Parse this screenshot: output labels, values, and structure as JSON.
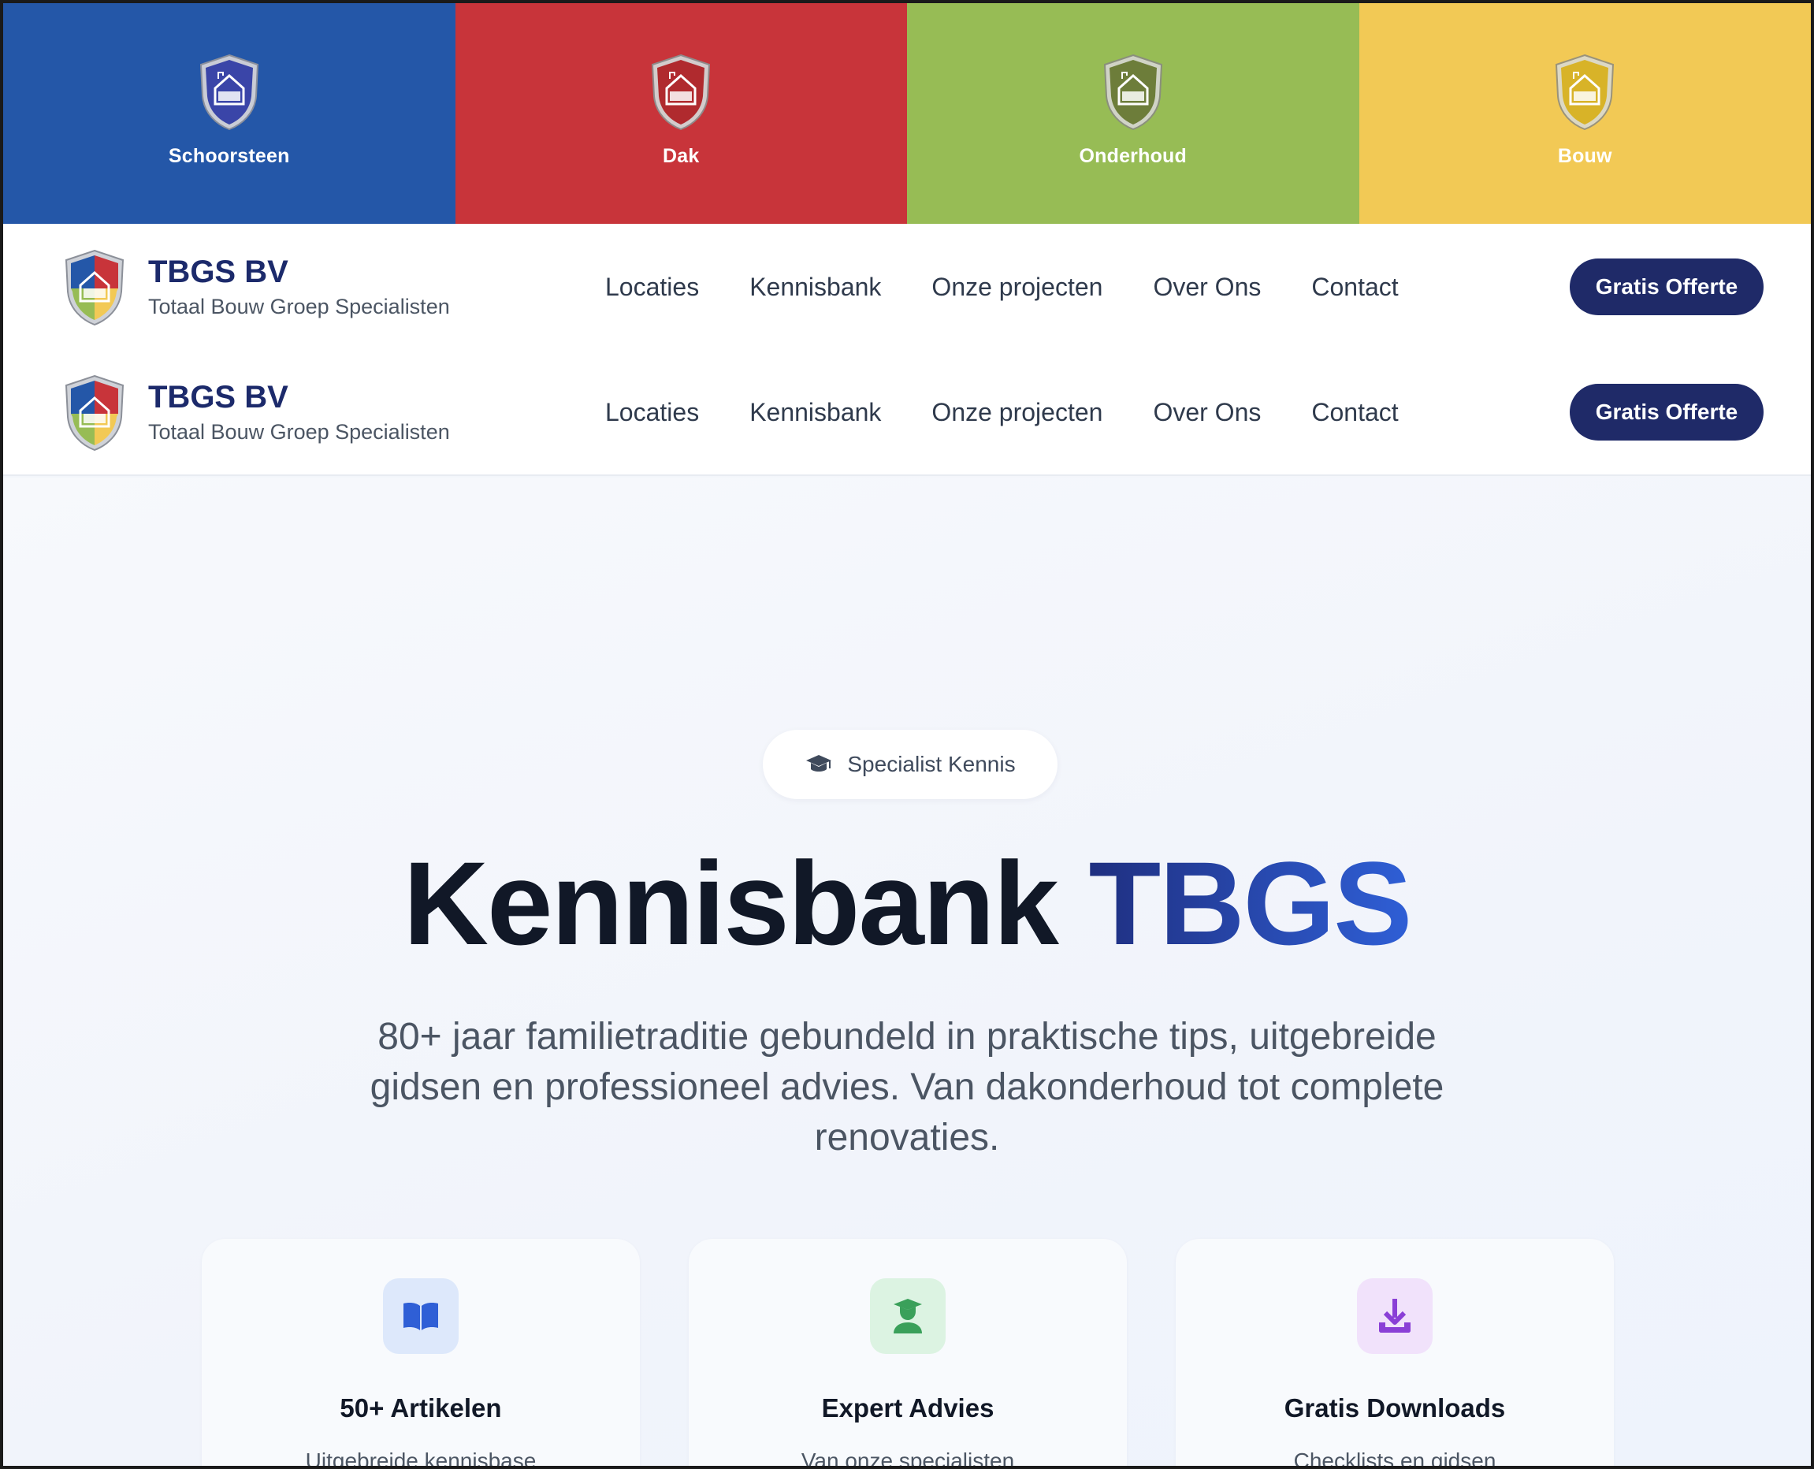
{
  "divisions": [
    {
      "label": "Schoorsteen",
      "color": "#2457a8",
      "shield": "#3a45a8"
    },
    {
      "label": "Dak",
      "color": "#c8343a",
      "shield": "#b02a2e"
    },
    {
      "label": "Onderhoud",
      "color": "#97bc55",
      "shield": "#6d7d3a"
    },
    {
      "label": "Bouw",
      "color": "#f2c955",
      "shield": "#d8b328"
    }
  ],
  "nav": {
    "brand_name": "TBGS BV",
    "brand_tagline": "Totaal Bouw Groep Specialisten",
    "menu": [
      "Locaties",
      "Kennisbank",
      "Onze projecten",
      "Over Ons",
      "Contact"
    ],
    "cta_label": "Gratis Offerte"
  },
  "hero": {
    "badge_icon": "graduation-cap-icon",
    "badge_label": "Specialist Kennis",
    "title_main": "Kennisbank",
    "title_accent": "TBGS",
    "subtitle": "80+ jaar familietraditie gebundeld in praktische tips, uitgebreide gidsen en professioneel advies. Van dakonderhoud tot complete renovaties."
  },
  "features": [
    {
      "icon": "open-book-icon",
      "title": "50+ Artikelen",
      "desc": "Uitgebreide kennisbase",
      "accent": "#2f5fd6"
    },
    {
      "icon": "graduate-user-icon",
      "title": "Expert Advies",
      "desc": "Van onze specialisten",
      "accent": "#3aa05a"
    },
    {
      "icon": "download-icon",
      "title": "Gratis Downloads",
      "desc": "Checklists en gidsen",
      "accent": "#8a3fd6"
    }
  ],
  "colors": {
    "brand_navy": "#1f2a68",
    "accent_blue": "#2f5fd6"
  }
}
